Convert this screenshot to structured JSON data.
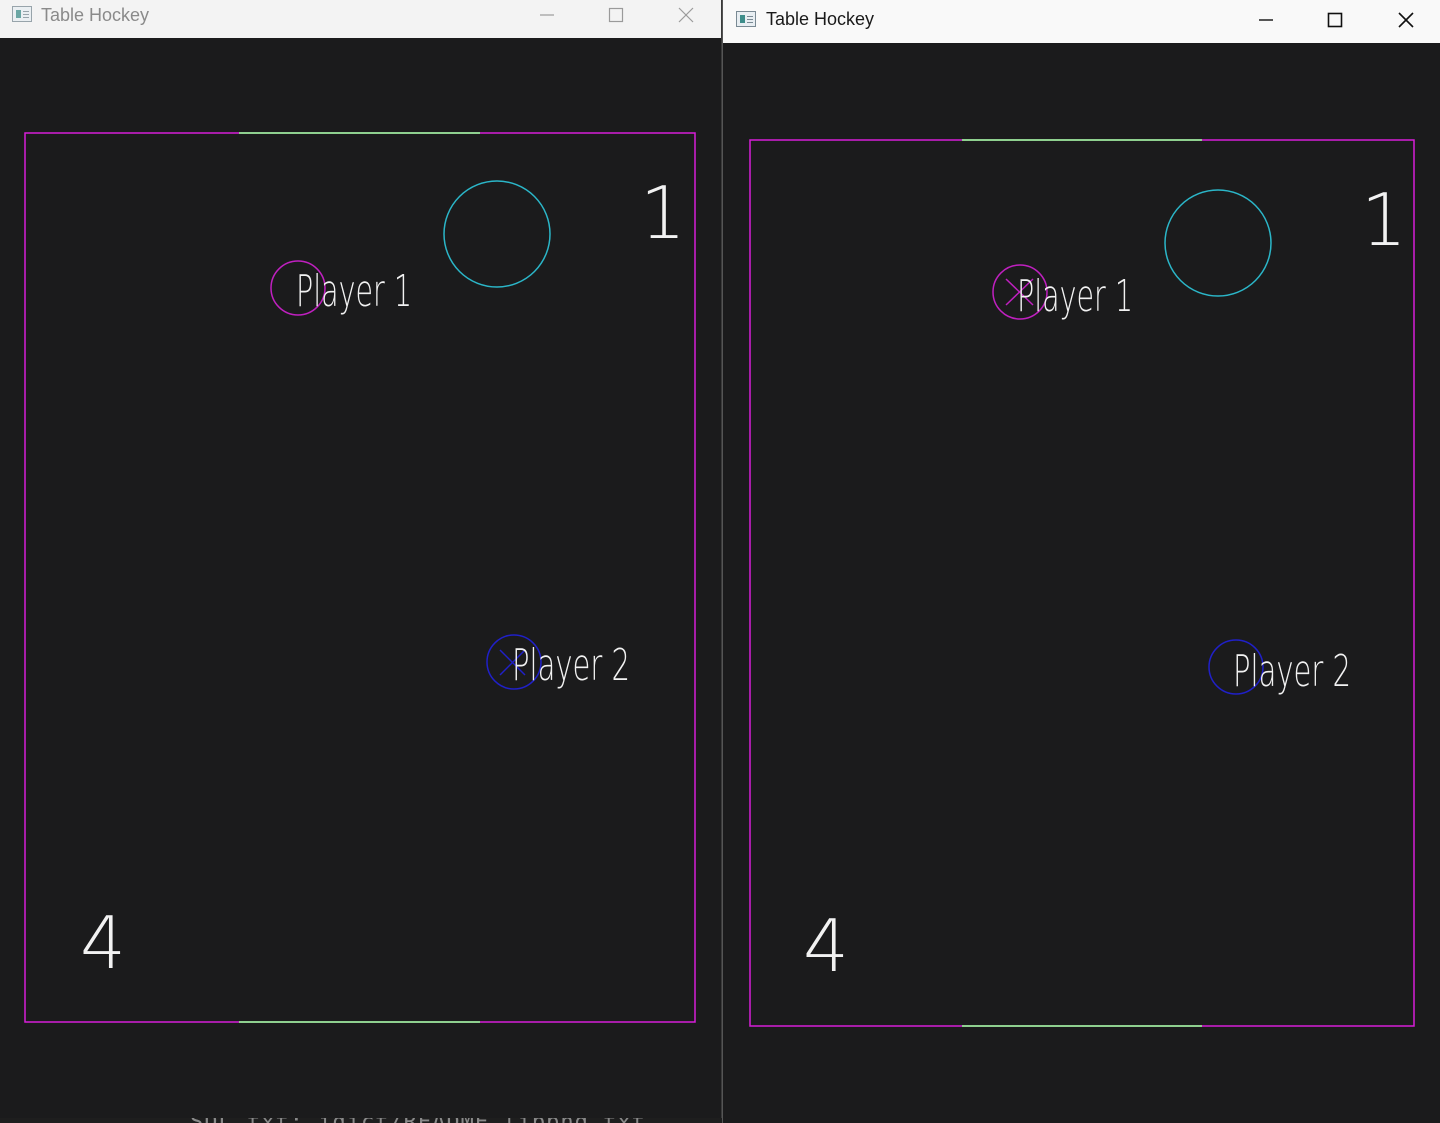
{
  "background": {
    "terminal_fragment": "SDL.txt; idict/README libpng.txt"
  },
  "windows": [
    {
      "id": "left",
      "active": false,
      "title": "Table Hockey",
      "controls": {
        "minimize": "minimize-icon",
        "maximize": "maximize-icon",
        "close": "close-icon"
      },
      "game": {
        "score_top": "1",
        "score_bottom": "4",
        "player1_label": "Player 1",
        "player2_label": "Player 2",
        "colors": {
          "rink": "#d81ed8",
          "goal": "#8fd08f",
          "puck": "#2bb6c8",
          "player1": "#c020c0",
          "player2": "#2020c8",
          "text": "#f2f2f2"
        }
      }
    },
    {
      "id": "right",
      "active": true,
      "title": "Table Hockey",
      "controls": {
        "minimize": "minimize-icon",
        "maximize": "maximize-icon",
        "close": "close-icon"
      },
      "game": {
        "score_top": "1",
        "score_bottom": "4",
        "player1_label": "Player 1",
        "player2_label": "Player 2",
        "colors": {
          "rink": "#d81ed8",
          "goal": "#8fd08f",
          "puck": "#2bb6c8",
          "player1": "#c020c0",
          "player2": "#2020c8",
          "text": "#f2f2f2"
        }
      }
    }
  ]
}
